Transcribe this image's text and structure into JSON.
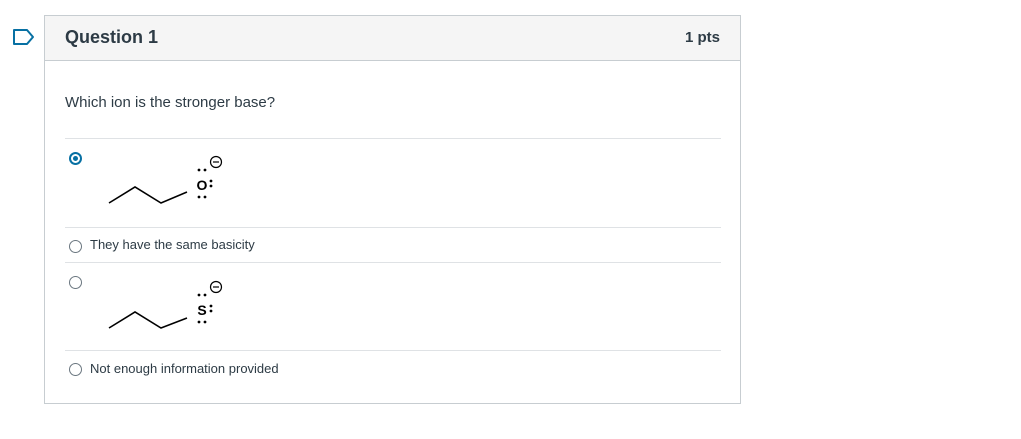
{
  "question": {
    "title": "Question 1",
    "points": "1 pts",
    "text": "Which ion is the stronger base?"
  },
  "answers": [
    {
      "type": "structure",
      "selected": true,
      "atom": "O",
      "charge": "⊖",
      "structure": "propoxide ion"
    },
    {
      "type": "text",
      "selected": false,
      "label": "They have the same basicity"
    },
    {
      "type": "structure",
      "selected": false,
      "atom": "S",
      "charge": "⊖",
      "structure": "propanethiolate ion"
    },
    {
      "type": "text",
      "selected": false,
      "label": "Not enough information provided"
    }
  ],
  "colors": {
    "accent": "#0770a3",
    "text": "#2d3b45",
    "border": "#c7cdd1",
    "header_bg": "#f5f5f5"
  },
  "icons": {
    "flag": "bookmark-flag-icon"
  }
}
